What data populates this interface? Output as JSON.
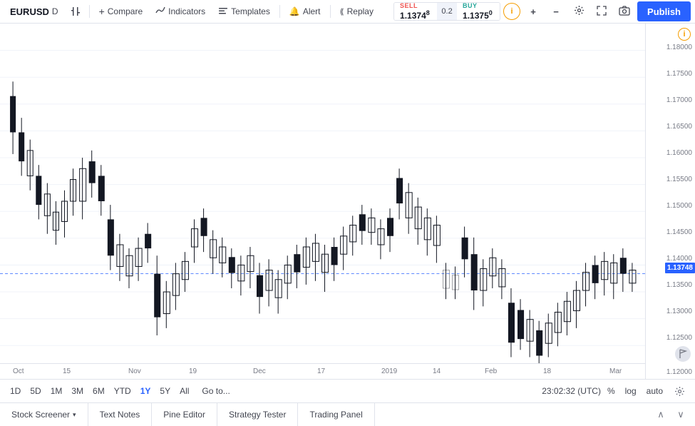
{
  "toolbar": {
    "symbol": "EURUSD",
    "timeframe": "D",
    "compare_label": "Compare",
    "indicators_label": "Indicators",
    "templates_label": "Templates",
    "alert_label": "Alert",
    "replay_label": "Replay",
    "sell_label": "SELL",
    "sell_price": "1.13748",
    "spread": "0.2",
    "buy_label": "BUY",
    "buy_price": "1.13750",
    "publish_label": "Publish"
  },
  "price_axis": {
    "current_price": "1.13748",
    "levels": [
      "1.18000",
      "1.17500",
      "1.17000",
      "1.16500",
      "1.16000",
      "1.15500",
      "1.15000",
      "1.14500",
      "1.14000",
      "1.13500",
      "1.13000",
      "1.12500",
      "1.12000"
    ]
  },
  "time_axis": {
    "labels": [
      "Oct",
      "15",
      "Nov",
      "19",
      "Dec",
      "17",
      "2019",
      "14",
      "Feb",
      "18",
      "Mar"
    ]
  },
  "bottom_toolbar": {
    "timeframes": [
      {
        "label": "1D",
        "active": false
      },
      {
        "label": "5D",
        "active": false
      },
      {
        "label": "1M",
        "active": false
      },
      {
        "label": "3M",
        "active": false
      },
      {
        "label": "6M",
        "active": false
      },
      {
        "label": "YTD",
        "active": false
      },
      {
        "label": "1Y",
        "active": true
      },
      {
        "label": "5Y",
        "active": false
      },
      {
        "label": "All",
        "active": false
      }
    ],
    "goto_label": "Go to...",
    "utc_label": "23:02:32 (UTC)",
    "pct_label": "%",
    "log_label": "log",
    "auto_label": "auto"
  },
  "bottom_panel": {
    "tabs": [
      {
        "label": "Stock Screener",
        "active": false,
        "has_arrow": true
      },
      {
        "label": "Text Notes",
        "active": false,
        "has_arrow": false
      },
      {
        "label": "Pine Editor",
        "active": false,
        "has_arrow": false
      },
      {
        "label": "Strategy Tester",
        "active": false,
        "has_arrow": false
      },
      {
        "label": "Trading Panel",
        "active": false,
        "has_arrow": false
      }
    ]
  },
  "chart": {
    "crosshair_price": "1.13748",
    "dashed_line_price": "1.13748"
  },
  "icons": {
    "bartype": "⊞",
    "compare": "+",
    "indicators": "∿",
    "templates": "☰",
    "alert": "🔔",
    "replay": "▶",
    "info": "i",
    "settings": "⚙",
    "fullscreen": "⛶",
    "camera": "📷",
    "plus": "+",
    "minus": "−",
    "gear": "⚙",
    "flag": "⚑",
    "up_arrow": "∧",
    "down_arrow": "∨"
  }
}
